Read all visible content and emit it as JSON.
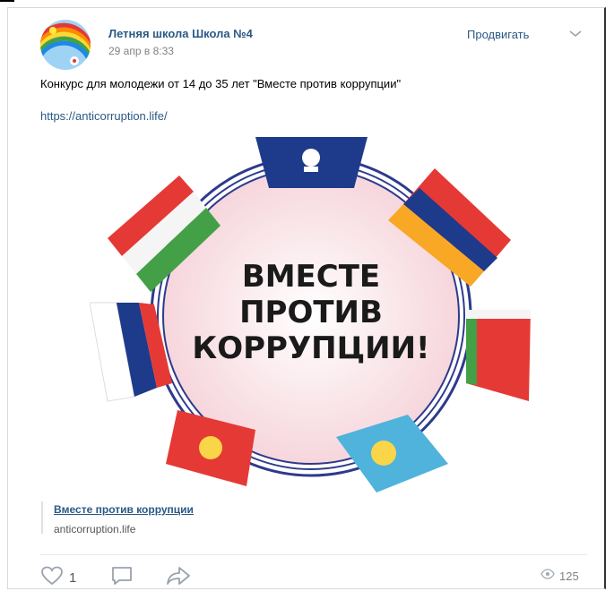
{
  "post": {
    "author": "Летняя школа Школа №4",
    "date": "29 апр в 8:33",
    "promote_label": "Продвигать",
    "text": "Конкурс для молодежи от 14 до 35 лет \"Вместе против коррупции\"",
    "link": "https://anticorruption.life/"
  },
  "poster": {
    "line1": "ВМЕСТЕ",
    "line2": "ПРОТИВ",
    "line3": "КОРРУПЦИИ!"
  },
  "attachment": {
    "title": "Вместе против коррупции",
    "domain": "anticorruption.life"
  },
  "actions": {
    "likes": "1",
    "views": "125"
  },
  "icons": [
    "chevron-down-icon",
    "heart-icon",
    "comment-icon",
    "share-icon",
    "eye-icon"
  ],
  "colors": {
    "link": "#2a5885",
    "muted": "#828282"
  }
}
